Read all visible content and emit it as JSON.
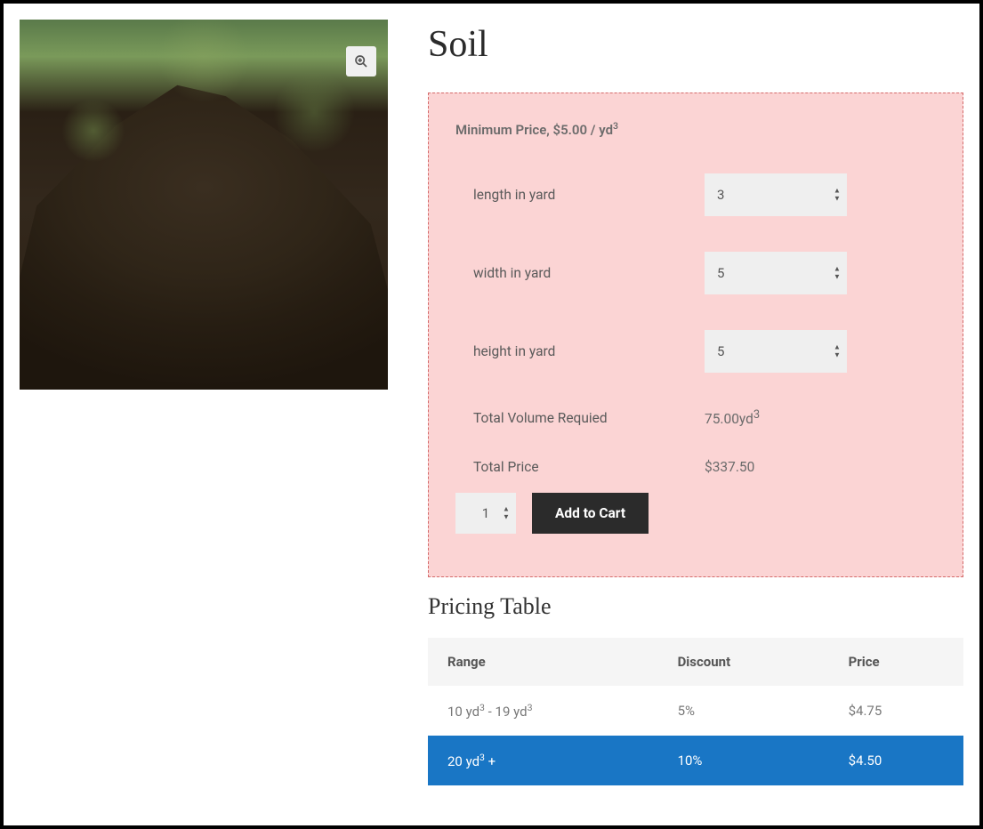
{
  "product": {
    "title": "Soil"
  },
  "calculator": {
    "min_price_prefix": "Minimum Price, $5.00 / yd",
    "min_price_sup": "3",
    "length_label": "length in yard",
    "length_value": "3",
    "width_label": "width in yard",
    "width_value": "5",
    "height_label": "height in yard",
    "height_value": "5",
    "volume_label": "Total Volume Requied",
    "volume_value": "75.00yd",
    "volume_sup": "3",
    "price_label": "Total Price",
    "price_value": "$337.50",
    "qty_value": "1",
    "add_to_cart_label": "Add to Cart"
  },
  "pricing": {
    "title": "Pricing Table",
    "headers": {
      "range": "Range",
      "discount": "Discount",
      "price": "Price"
    },
    "rows": [
      {
        "range_a": "10 yd",
        "range_sup_a": "3",
        "range_mid": " - 19 yd",
        "range_sup_b": "3",
        "range_tail": "",
        "discount": "5%",
        "price": "$4.75",
        "active": false
      },
      {
        "range_a": "20 yd",
        "range_sup_a": "3",
        "range_mid": "",
        "range_sup_b": "",
        "range_tail": " +",
        "discount": "10%",
        "price": "$4.50",
        "active": true
      }
    ]
  }
}
